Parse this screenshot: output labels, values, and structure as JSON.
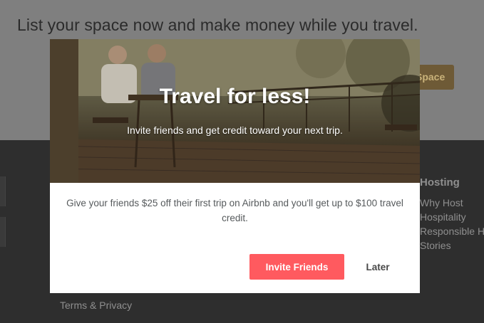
{
  "background": {
    "headline": "List your space now and make money while you travel.",
    "cta_button": "Space",
    "footer": {
      "hosting_title": "Hosting",
      "hosting_links": [
        "Why Host",
        "Hospitality",
        "Responsible Host",
        "Stories"
      ],
      "terms_link": "Terms & Privacy"
    }
  },
  "modal": {
    "title": "Travel for less!",
    "subtitle": "Invite friends and get credit toward your next trip.",
    "body": "Give your friends $25 off their first trip on Airbnb and you'll get up to $100 travel credit.",
    "invite_button": "Invite Friends",
    "later_button": "Later"
  },
  "colors": {
    "accent": "#ff5a5f",
    "body_text": "#565a5c"
  }
}
